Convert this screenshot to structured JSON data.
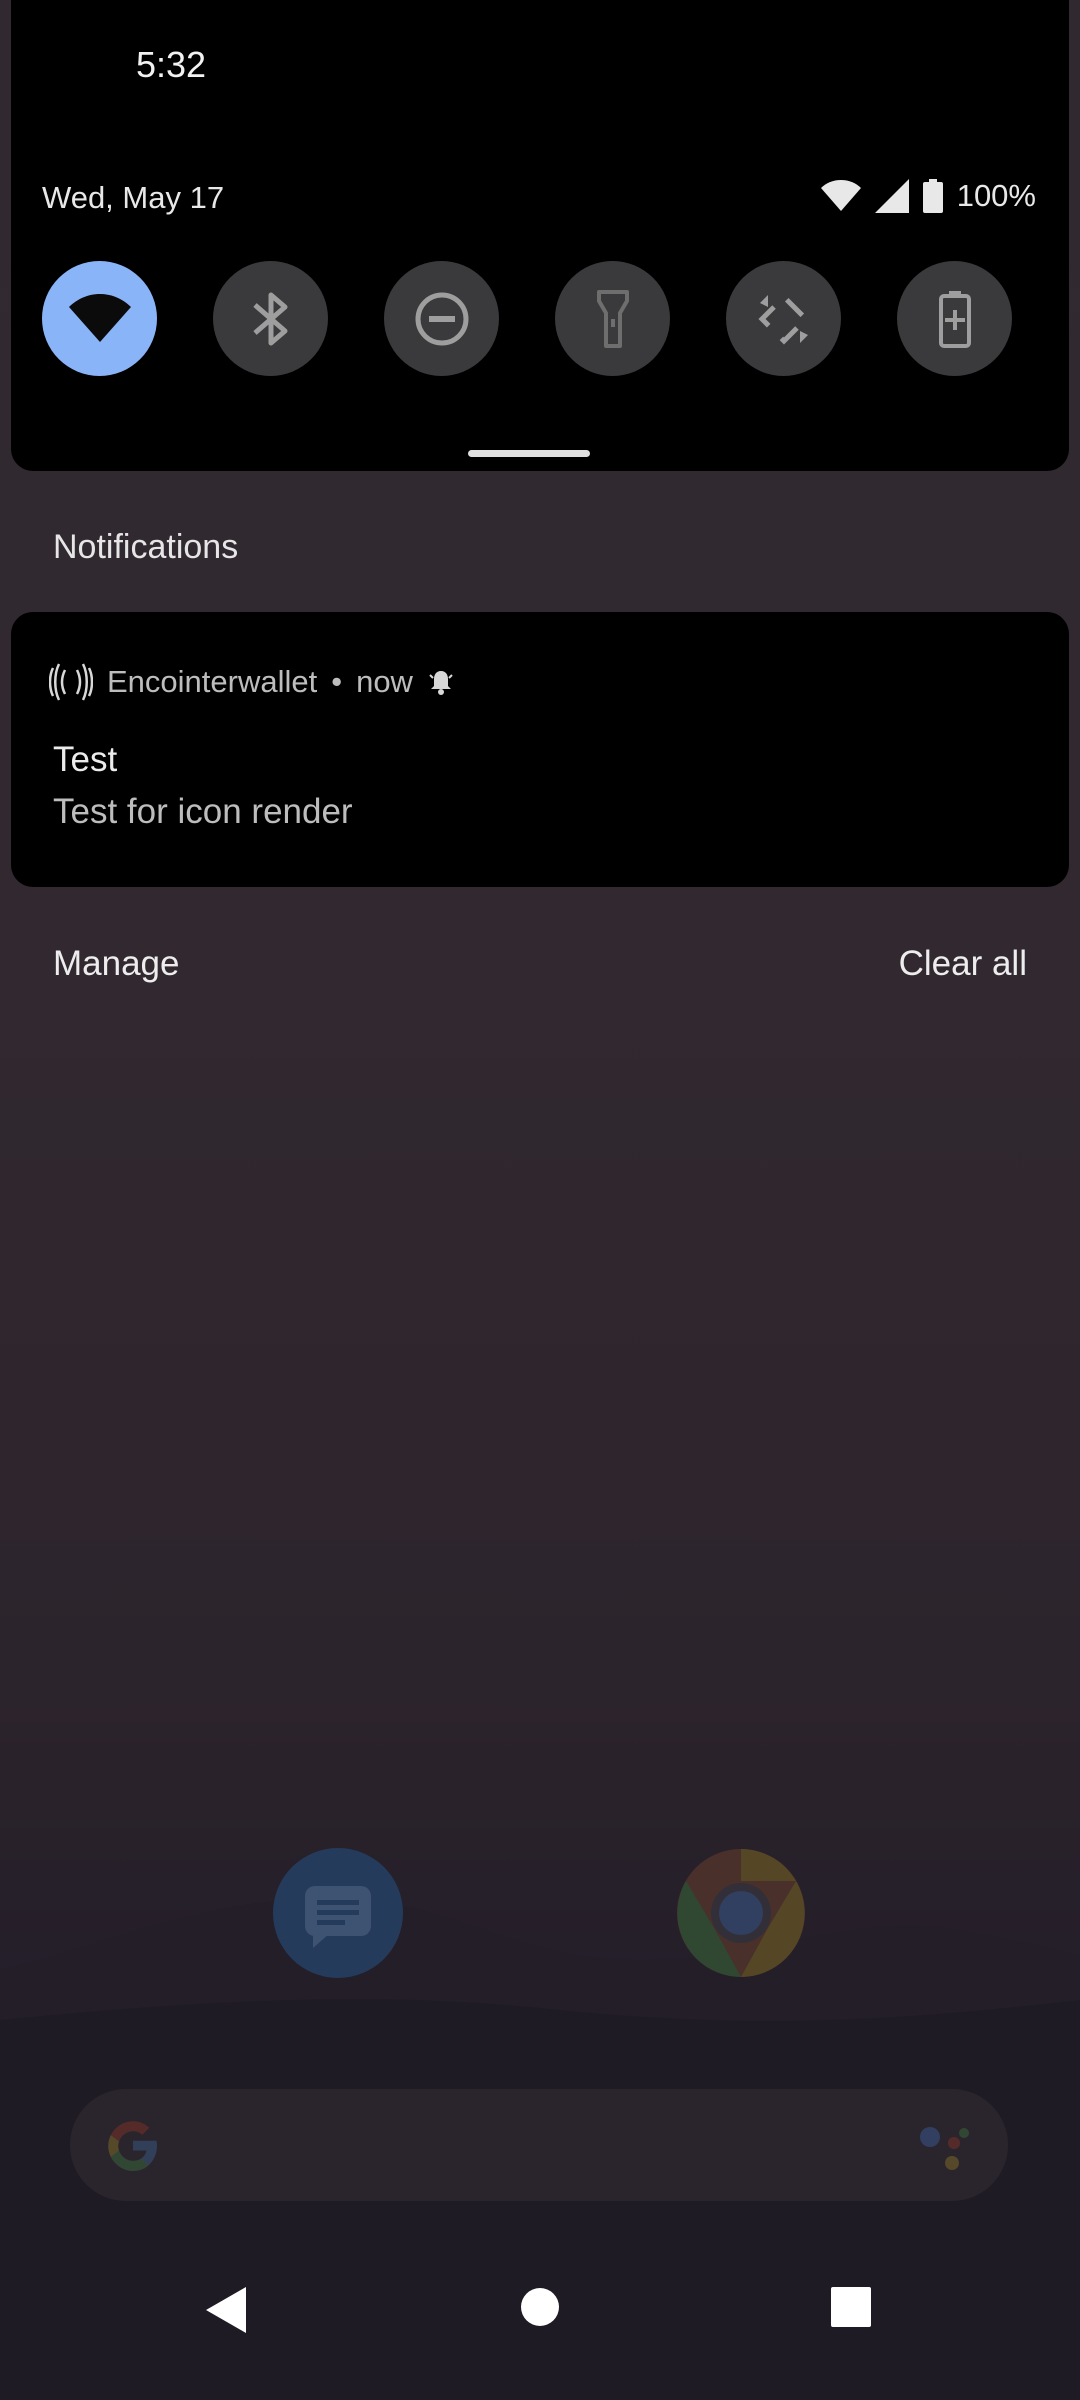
{
  "status_bar": {
    "time": "5:32"
  },
  "quick_settings": {
    "date": "Wed, May 17",
    "battery_text": "100%",
    "tiles": [
      {
        "name": "wifi",
        "active": true
      },
      {
        "name": "bluetooth",
        "active": false
      },
      {
        "name": "do-not-disturb",
        "active": false
      },
      {
        "name": "flashlight",
        "active": false
      },
      {
        "name": "auto-rotate",
        "active": false
      },
      {
        "name": "battery-saver",
        "active": false
      }
    ]
  },
  "notifications": {
    "header": "Notifications",
    "items": [
      {
        "app": "Encointerwallet",
        "separator": "•",
        "time": "now",
        "title": "Test",
        "text": "Test for icon render"
      }
    ],
    "manage_label": "Manage",
    "clear_label": "Clear all"
  },
  "colors": {
    "active_tile": "#8ab4f8",
    "tile": "#3a3a3c",
    "panel": "#000000"
  }
}
